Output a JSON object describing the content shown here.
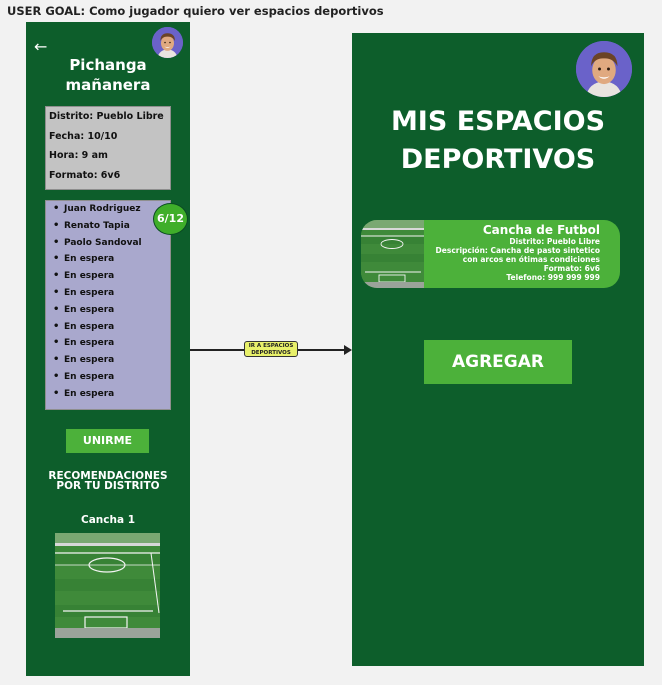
{
  "user_goal": "USER GOAL: Como jugador quiero ver espacios deportivos",
  "left_screen": {
    "title_line1": "Pichanga",
    "title_line2": "mañanera",
    "info": {
      "distrito": "Distrito: Pueblo Libre",
      "fecha": "Fecha: 10/10",
      "hora": "Hora: 9 am",
      "formato": "Formato: 6v6"
    },
    "players": [
      "Juan Rodriguez",
      "Renato Tapia",
      "Paolo Sandoval",
      "En espera",
      "En espera",
      "En espera",
      "En espera",
      "En espera",
      "En espera",
      "En espera",
      "En espera",
      "En espera"
    ],
    "counter": "6/12",
    "join_button": "UNIRME",
    "recommendations_line1": "RECOMENDACIONES",
    "recommendations_line2": "POR TU DISTRITO",
    "cancha_title": "Cancha 1"
  },
  "connector": {
    "label_line1": "IR A ESPACIOS",
    "label_line2": "DEPORTIVOS"
  },
  "right_screen": {
    "title_line1": "MIS ESPACIOS",
    "title_line2": "DEPORTIVOS",
    "card": {
      "name": "Cancha de Futbol",
      "distrito": "Distrito: Pueblo Libre",
      "descripcion_1": "Descripción: Cancha de pasto sintetico",
      "descripcion_2": "con arcos en ótimas condiciones",
      "formato": "Formato: 6v6",
      "telefono": "Telefono: 999 999 999"
    },
    "add_button": "AGREGAR"
  },
  "colors": {
    "screen_bg": "#0d5e2b",
    "accent_green": "#4cb13a",
    "info_box": "#c3c3c3",
    "players_box": "#a9a8cd",
    "connector_label": "#e8f06a",
    "avatar_bg": "#6a62c9"
  },
  "icons": [
    "back-arrow-icon",
    "avatar",
    "field-image"
  ]
}
